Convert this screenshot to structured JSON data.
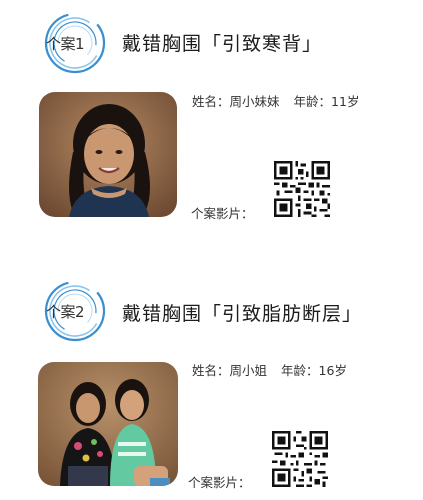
{
  "cases": [
    {
      "badge": "个案1",
      "title": "戴错胸围「引致寒背」",
      "name_label": "姓名：",
      "name": "周小妹妹",
      "age_label": "年龄：",
      "age": "11岁",
      "video_label": "个案影片："
    },
    {
      "badge": "个案2",
      "title": "戴错胸围「引致脂肪断层」",
      "name_label": "姓名：",
      "name": "周小姐",
      "age_label": "年龄：",
      "age": "16岁",
      "video_label": "个案影片："
    }
  ],
  "colors": {
    "badge_ring": "#3a8fd0",
    "badge_ring_light": "#8cc6ec",
    "text": "#222222"
  }
}
